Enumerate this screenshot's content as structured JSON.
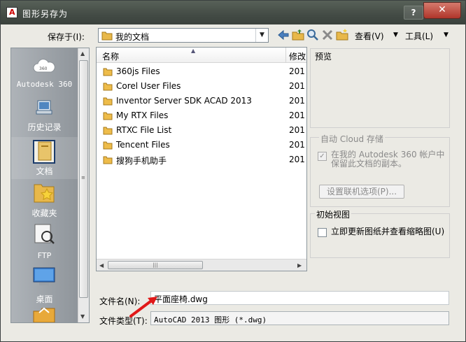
{
  "window": {
    "title": "图形另存为",
    "help_label": "?",
    "close_label": "✕",
    "app_icon_label": "A"
  },
  "toolbar": {
    "save_in_label": "保存于(I):",
    "location": "我的文档",
    "view_label": "查看(V)",
    "tools_label": "工具(L)"
  },
  "places": [
    {
      "label": "Autodesk 360",
      "icon": "cloud-icon"
    },
    {
      "label": "历史记录",
      "icon": "history-icon"
    },
    {
      "label": "文档",
      "icon": "documents-icon"
    },
    {
      "label": "收藏夹",
      "icon": "favorites-icon"
    },
    {
      "label": "FTP",
      "icon": "ftp-icon"
    },
    {
      "label": "桌面",
      "icon": "desktop-icon"
    }
  ],
  "file_list": {
    "columns": {
      "name": "名称",
      "modified": "修改"
    },
    "rows": [
      {
        "name": "360js Files",
        "modified": "201"
      },
      {
        "name": "Corel User Files",
        "modified": "201"
      },
      {
        "name": "Inventor Server SDK ACAD 2013",
        "modified": "201"
      },
      {
        "name": "My RTX Files",
        "modified": "201"
      },
      {
        "name": "RTXC File List",
        "modified": "201"
      },
      {
        "name": "Tencent Files",
        "modified": "201"
      },
      {
        "name": "搜狗手机助手",
        "modified": "201"
      }
    ]
  },
  "preview": {
    "title": "预览"
  },
  "cloud": {
    "title": "自动 Cloud 存储",
    "checkbox_text": "在我的 Autodesk 360 帐户中保留此文档的副本。",
    "checked": true,
    "button_label": "设置联机选项(P)..."
  },
  "initial_view": {
    "title": "初始视图",
    "checkbox_text": "立即更新图纸并查看缩略图(U)",
    "checked": false
  },
  "filename": {
    "label": "文件名(N):",
    "value": "平面座椅.dwg"
  },
  "filetype": {
    "label": "文件类型(T):",
    "value": "AutoCAD 2013 图形 (*.dwg)"
  },
  "colors": {
    "title_bar": "#434b45",
    "close_button": "#c0483c",
    "accent_arrow": "#e01818"
  }
}
